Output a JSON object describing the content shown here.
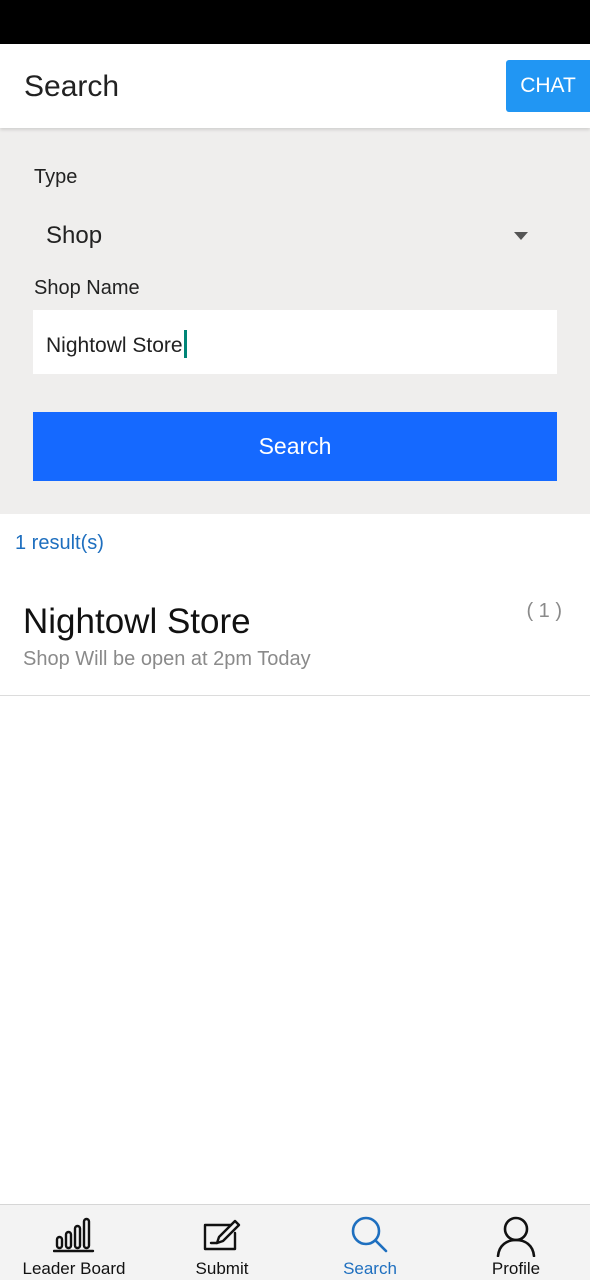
{
  "header": {
    "title": "Search",
    "chat_label": "CHAT"
  },
  "form": {
    "type_label": "Type",
    "type_value": "Shop",
    "shop_name_label": "Shop Name",
    "shop_name_value": "Nightowl Store",
    "search_button_label": "Search"
  },
  "results": {
    "count_text": "1 result(s)",
    "items": [
      {
        "title": "Nightowl Store",
        "subtitle": "Shop Will be open at 2pm Today",
        "count": "( 1 )"
      }
    ]
  },
  "bottom_nav": {
    "items": [
      {
        "label": "Leader Board",
        "icon": "bar-chart-icon",
        "active": false
      },
      {
        "label": "Submit",
        "icon": "edit-icon",
        "active": false
      },
      {
        "label": "Search",
        "icon": "search-icon",
        "active": true
      },
      {
        "label": "Profile",
        "icon": "person-icon",
        "active": false
      }
    ]
  },
  "colors": {
    "accent_blue": "#1569ff",
    "chat_blue": "#2196f3",
    "link_blue": "#1e6fbf",
    "panel_bg": "#efeeed",
    "caret_teal": "#008577"
  }
}
